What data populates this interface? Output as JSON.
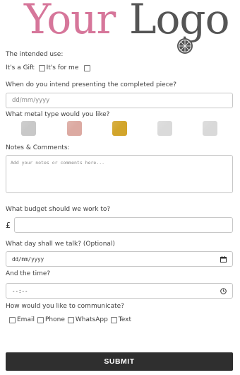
{
  "logo": {
    "part1": "Your",
    "part2": "Logo",
    "part1_color": "#d6769a",
    "part2_color": "#555555"
  },
  "intended_use": {
    "label": "The intended use:",
    "options": [
      "It's a Gift",
      "It's for me"
    ]
  },
  "presenting_date": {
    "label": "When do you intend presenting the completed piece?",
    "placeholder": "dd/mm/yyyy"
  },
  "metal": {
    "label": "What metal type would you like?",
    "swatches": [
      {
        "name": "silver",
        "color": "#c8c8c8"
      },
      {
        "name": "rose-gold",
        "color": "#dcaaa2"
      },
      {
        "name": "yellow-gold",
        "color": "#d2a52b"
      },
      {
        "name": "white-gold",
        "color": "#dadada"
      },
      {
        "name": "platinum",
        "color": "#d9d9d9"
      }
    ]
  },
  "notes": {
    "label": "Notes & Comments:",
    "placeholder": "Add your notes or comments here..."
  },
  "budget": {
    "label": "What budget should we work to?",
    "currency_symbol": "£"
  },
  "talk_day": {
    "label": "What day shall we talk? (Optional)",
    "placeholder": "dd/mm/yyyy"
  },
  "talk_time": {
    "label": "And the time?",
    "placeholder": "--:--"
  },
  "communicate": {
    "label": "How would you like to communicate?",
    "options": [
      "Email",
      "Phone",
      "WhatsApp",
      "Text"
    ]
  },
  "submit_label": "SUBMIT"
}
